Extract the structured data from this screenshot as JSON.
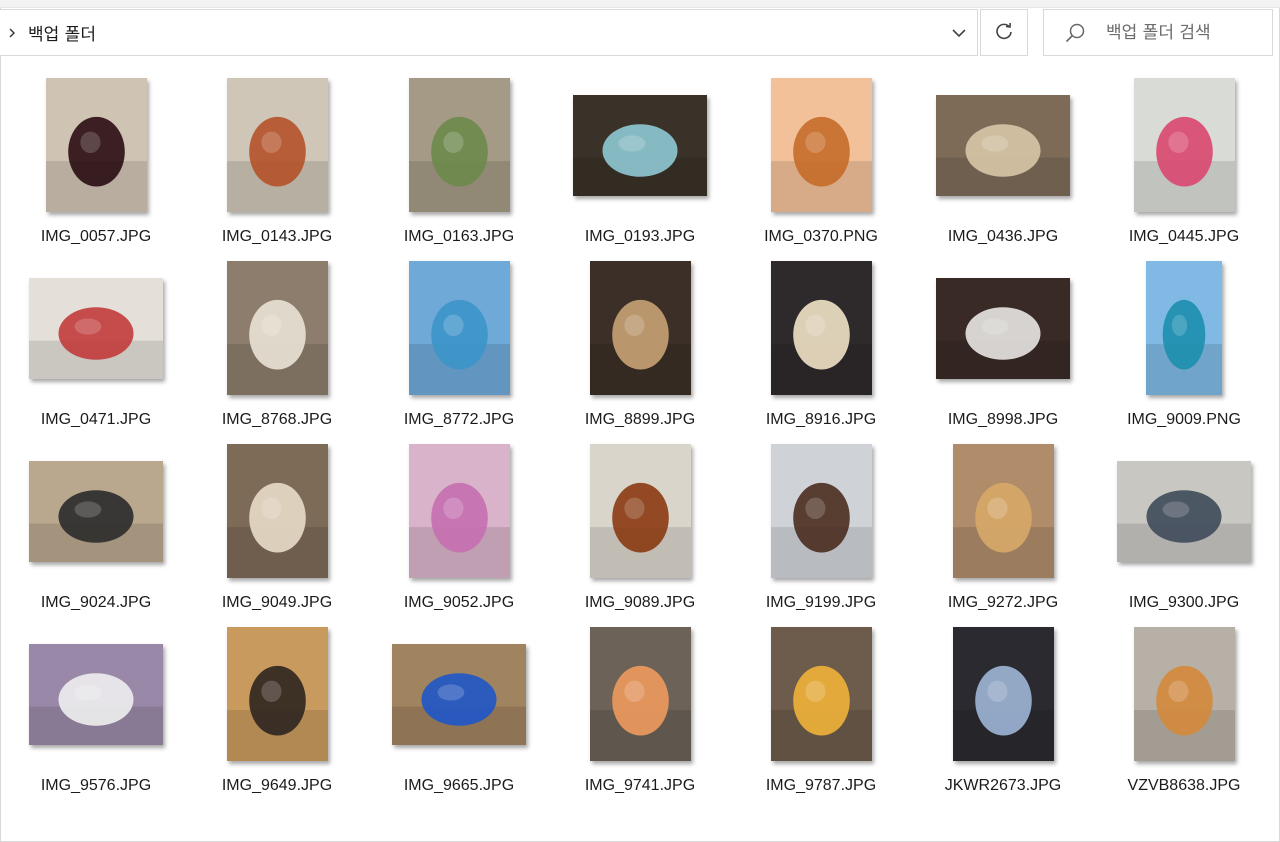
{
  "address_bar": {
    "path": "백업 폴더",
    "chevron_icon": "chevron-right-icon",
    "dropdown_icon": "chevron-down-icon"
  },
  "refresh_icon": "refresh-icon",
  "search": {
    "placeholder": "백업 폴더 검색",
    "icon": "search-icon"
  },
  "files": [
    {
      "name": "IMG_0057.JPG",
      "orient": "portrait",
      "bg": "#cfc3b3",
      "accent": "#2a0d12"
    },
    {
      "name": "IMG_0143.JPG",
      "orient": "portrait",
      "bg": "#cfc6b8",
      "accent": "#b4522a"
    },
    {
      "name": "IMG_0163.JPG",
      "orient": "portrait",
      "bg": "#a59a85",
      "accent": "#6c8a4b"
    },
    {
      "name": "IMG_0193.JPG",
      "orient": "landscape",
      "bg": "#3a3228",
      "accent": "#8fc9d4"
    },
    {
      "name": "IMG_0370.PNG",
      "orient": "portrait",
      "bg": "#f2c199",
      "accent": "#c56b2a"
    },
    {
      "name": "IMG_0436.JPG",
      "orient": "landscape",
      "bg": "#7d6b58",
      "accent": "#d8c7a7"
    },
    {
      "name": "IMG_0445.JPG",
      "orient": "portrait",
      "bg": "#d9dcd6",
      "accent": "#d9476f"
    },
    {
      "name": "IMG_0471.JPG",
      "orient": "landscape",
      "bg": "#e4e0d9",
      "accent": "#c23b3b"
    },
    {
      "name": "IMG_8768.JPG",
      "orient": "portrait",
      "bg": "#8d7d6c",
      "accent": "#e9e2d6"
    },
    {
      "name": "IMG_8772.JPG",
      "orient": "portrait",
      "bg": "#6fa9d8",
      "accent": "#3d95c9"
    },
    {
      "name": "IMG_8899.JPG",
      "orient": "portrait",
      "bg": "#3b2f27",
      "accent": "#c9a275"
    },
    {
      "name": "IMG_8916.JPG",
      "orient": "portrait",
      "bg": "#2e2a2b",
      "accent": "#efe2c7"
    },
    {
      "name": "IMG_8998.JPG",
      "orient": "landscape",
      "bg": "#3a2a26",
      "accent": "#e8e6e3"
    },
    {
      "name": "IMG_9009.PNG",
      "orient": "narrow",
      "bg": "#7fb9e4",
      "accent": "#1d8fae"
    },
    {
      "name": "IMG_9024.JPG",
      "orient": "landscape",
      "bg": "#b9a78e",
      "accent": "#2b2b2b"
    },
    {
      "name": "IMG_9049.JPG",
      "orient": "portrait",
      "bg": "#7d6a57",
      "accent": "#e8dcc8"
    },
    {
      "name": "IMG_9052.JPG",
      "orient": "portrait",
      "bg": "#d8b3c9",
      "accent": "#c56fb0"
    },
    {
      "name": "IMG_9089.JPG",
      "orient": "portrait",
      "bg": "#d9d5cb",
      "accent": "#8a3a12"
    },
    {
      "name": "IMG_9199.JPG",
      "orient": "portrait",
      "bg": "#cfd3d8",
      "accent": "#4a2c1f"
    },
    {
      "name": "IMG_9272.JPG",
      "orient": "portrait",
      "bg": "#b08c6a",
      "accent": "#d7a968"
    },
    {
      "name": "IMG_9300.JPG",
      "orient": "landscape",
      "bg": "#c9c7c2",
      "accent": "#3e4a5a"
    },
    {
      "name": "IMG_9576.JPG",
      "orient": "landscape",
      "bg": "#9a88a8",
      "accent": "#eeeeee"
    },
    {
      "name": "IMG_9649.JPG",
      "orient": "portrait",
      "bg": "#c99a5e",
      "accent": "#2d2620"
    },
    {
      "name": "IMG_9665.JPG",
      "orient": "landscape",
      "bg": "#a0835f",
      "accent": "#1f57c9"
    },
    {
      "name": "IMG_9741.JPG",
      "orient": "portrait",
      "bg": "#6c6258",
      "accent": "#f09a5e"
    },
    {
      "name": "IMG_9787.JPG",
      "orient": "portrait",
      "bg": "#6d5b4c",
      "accent": "#f0b33a"
    },
    {
      "name": "JKWR2673.JPG",
      "orient": "portrait",
      "bg": "#2a2a30",
      "accent": "#9fb6d6"
    },
    {
      "name": "VZVB8638.JPG",
      "orient": "portrait",
      "bg": "#b7b0a6",
      "accent": "#d48a3c"
    }
  ]
}
